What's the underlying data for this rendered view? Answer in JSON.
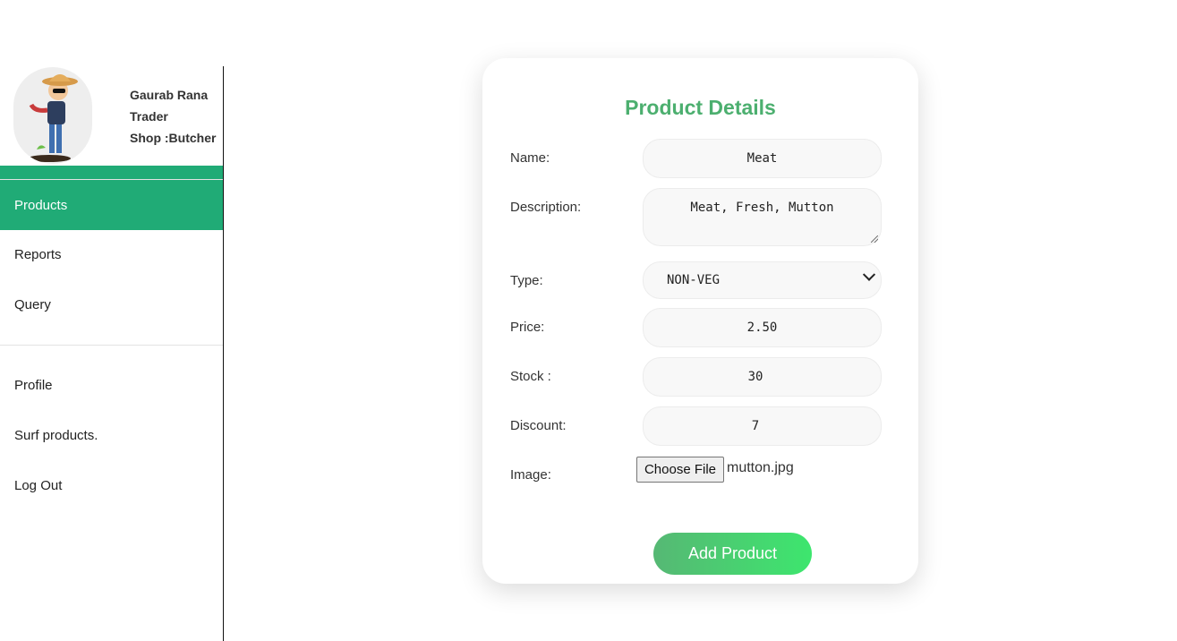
{
  "user": {
    "name": "Gaurab Rana",
    "role": "Trader",
    "shop": "Shop :Butcher"
  },
  "sidebar": {
    "main_items": [
      {
        "label": "Products",
        "active": true
      },
      {
        "label": "Reports"
      },
      {
        "label": "Query"
      }
    ],
    "bottom_items": [
      {
        "label": "Profile"
      },
      {
        "label": "Surf products."
      },
      {
        "label": "Log Out"
      }
    ],
    "accent_color": "#20ab76"
  },
  "form": {
    "title": "Product Details",
    "title_color": "#4caf6f",
    "name_label": "Name:",
    "name_value": "Meat",
    "description_label": "Description:",
    "description_value": "Meat, Fresh, Mutton",
    "type_label": "Type:",
    "type_value": "NON-VEG",
    "price_label": "Price:",
    "price_value": "2.50",
    "stock_label": "Stock :",
    "stock_value": "30",
    "discount_label": "Discount:",
    "discount_value": "7",
    "image_label": "Image:",
    "file_button_label": "Choose File",
    "file_name": "mutton.jpg",
    "submit_label": "Add Product"
  }
}
